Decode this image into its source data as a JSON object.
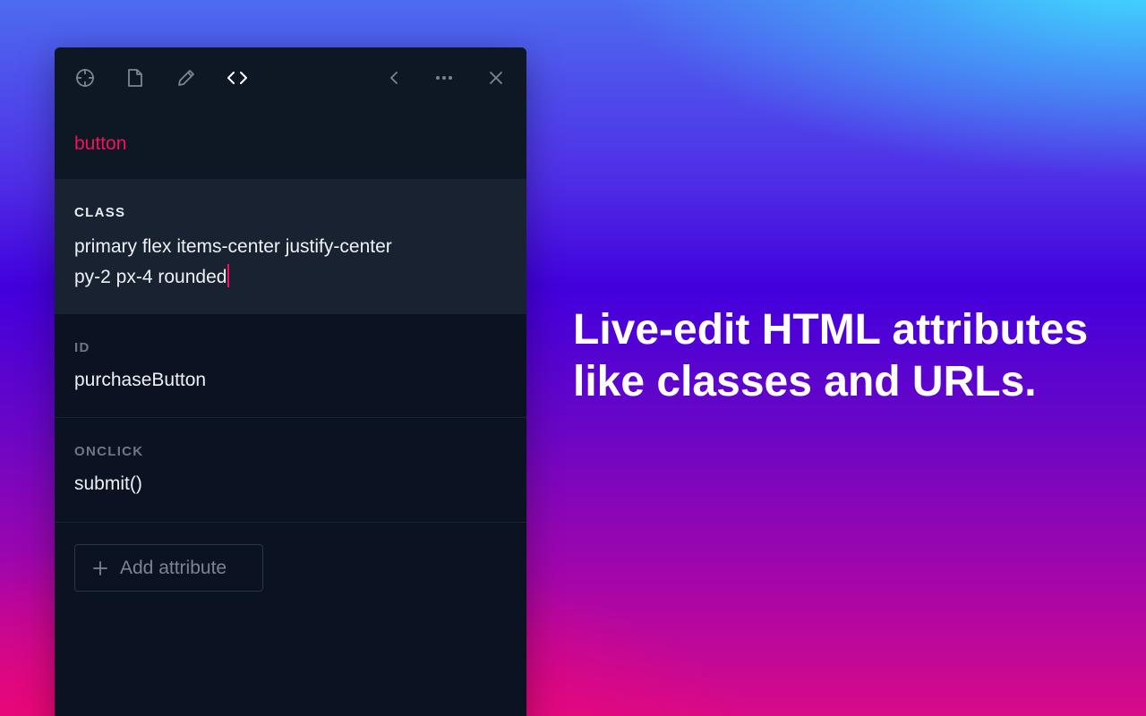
{
  "toolbar": {
    "icons": [
      "crosshair-icon",
      "file-icon",
      "pencil-icon",
      "code-icon",
      "chevron-left-icon",
      "more-icon",
      "close-icon"
    ],
    "active_color": "#ffffff",
    "inactive_color": "#7d8593"
  },
  "element": {
    "name": "button",
    "color": "#f5105f"
  },
  "attributes": [
    {
      "label": "CLASS",
      "value_lines": [
        "primary flex items-center justify-center",
        "py-2 px-4 rounded"
      ]
    },
    {
      "label": "ID",
      "value": "purchaseButton"
    },
    {
      "label": "ONCLICK",
      "value": "submit()"
    }
  ],
  "add_attribute": {
    "label": "Add attribute"
  },
  "headline": {
    "lines": [
      "Live-edit HTML attributes",
      "like classes and URLs."
    ]
  }
}
